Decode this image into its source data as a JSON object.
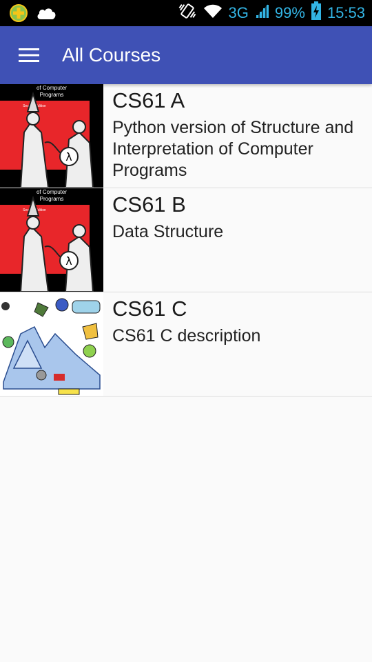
{
  "status_bar": {
    "network": "3G",
    "battery": "99%",
    "time": "15:53",
    "icons": [
      "plus-notification-icon",
      "cloud-icon",
      "vibrate-icon",
      "wifi-icon",
      "signal-icon",
      "battery-charging-icon"
    ]
  },
  "app_bar": {
    "title": "All Courses",
    "menu_icon": "hamburger-menu-icon"
  },
  "courses": [
    {
      "title": "CS61 A",
      "description": "Python version of Structure and Interpretation of Computer Programs",
      "thumbnail": "sicp-book-cover",
      "thumb_caption": [
        "of Computer",
        "Programs",
        "Second Edition"
      ]
    },
    {
      "title": "CS61 B",
      "description": "Data Structure",
      "thumbnail": "sicp-book-cover",
      "thumb_caption": [
        "of Computer",
        "Programs",
        "Second Edition"
      ]
    },
    {
      "title": "CS61 C",
      "description": "CS61 C description",
      "thumbnail": "cartoon-illustration",
      "thumb_caption": []
    }
  ],
  "colors": {
    "primary": "#3f51b5",
    "status_accent": "#33b5e5",
    "book_red": "#e8262a"
  }
}
